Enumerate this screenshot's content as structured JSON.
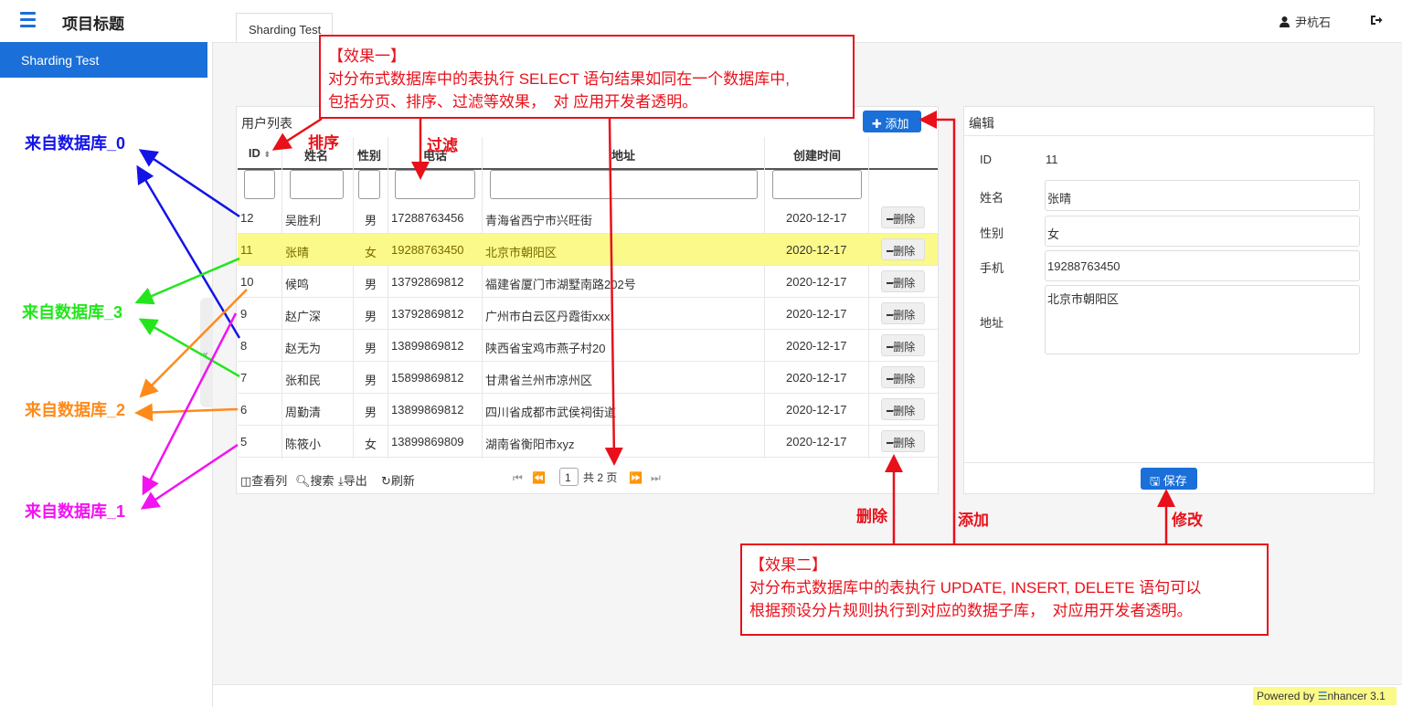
{
  "header": {
    "project_title": "项目标题",
    "tab": "Sharding Test",
    "user": "尹杭石"
  },
  "sidebar": {
    "items": [
      {
        "label": "Sharding Test"
      }
    ]
  },
  "db_labels": {
    "db0": "来自数据库_0",
    "db3": "来自数据库_3",
    "db2": "来自数据库_2",
    "db1": "来自数据库_1"
  },
  "callout1": {
    "title": "【效果一】",
    "line1": "对分布式数据库中的表执行 SELECT 语句结果如同在一个数据库中,",
    "line2": "包括分页、排序、过滤等效果，　对 应用开发者透明。"
  },
  "callout2": {
    "title": "【效果二】",
    "line1": "对分布式数据库中的表执行 UPDATE, INSERT, DELETE 语句可以",
    "line2": "根据预设分片规则执行到对应的数据子库，　对应用开发者透明。"
  },
  "annotations": {
    "sort": "排序",
    "filter": "过滤",
    "delete": "删除",
    "add": "添加",
    "modify": "修改"
  },
  "list_panel": {
    "title": "用户列表",
    "add_button": "添加",
    "columns": [
      "ID",
      "姓名",
      "性别",
      "电话",
      "地址",
      "创建时间"
    ],
    "delete_label": "删除",
    "rows": [
      {
        "id": "12",
        "name": "吴胜利",
        "gender": "男",
        "phone": "17288763456",
        "address": "青海省西宁市兴旺街",
        "created": "2020-12-17"
      },
      {
        "id": "11",
        "name": "张晴",
        "gender": "女",
        "phone": "19288763450",
        "address": "北京市朝阳区",
        "created": "2020-12-17"
      },
      {
        "id": "10",
        "name": "候鸣",
        "gender": "男",
        "phone": "13792869812",
        "address": "福建省厦门市湖墅南路202号",
        "created": "2020-12-17"
      },
      {
        "id": "9",
        "name": "赵广深",
        "gender": "男",
        "phone": "13792869812",
        "address": "广州市白云区丹霞街xxx",
        "created": "2020-12-17"
      },
      {
        "id": "8",
        "name": "赵无为",
        "gender": "男",
        "phone": "13899869812",
        "address": "陕西省宝鸡市燕子村20",
        "created": "2020-12-17"
      },
      {
        "id": "7",
        "name": "张和民",
        "gender": "男",
        "phone": "15899869812",
        "address": "甘肃省兰州市凉州区",
        "created": "2020-12-17"
      },
      {
        "id": "6",
        "name": "周勤清",
        "gender": "男",
        "phone": "13899869812",
        "address": "四川省成都市武侯祠街道",
        "created": "2020-12-17"
      },
      {
        "id": "5",
        "name": "陈筱小",
        "gender": "女",
        "phone": "13899869809",
        "address": "湖南省衡阳市xyz",
        "created": "2020-12-17"
      }
    ],
    "toolbar": {
      "columns": "查看列",
      "search": "搜索",
      "export": "导出",
      "refresh": "刷新"
    },
    "pager": {
      "page": "1",
      "total": "共 2 页"
    }
  },
  "edit_panel": {
    "title": "编辑",
    "id_label": "ID",
    "id_value": "11",
    "name_label": "姓名",
    "name_value": "张晴",
    "gender_label": "性别",
    "gender_value": "女",
    "phone_label": "手机",
    "phone_value": "19288763450",
    "address_label": "地址",
    "address_value": "北京市朝阳区",
    "save_button": "保存"
  },
  "footer": {
    "powered": "Powered by ",
    "brand_rest": "nhancer 3.1"
  },
  "colors": {
    "primary": "#1a6fd8",
    "highlight": "#fbf98a",
    "annotation": "#e8101a",
    "db0": "#1414e6",
    "db3": "#22e61c",
    "db2": "#ff8a1a",
    "db1": "#f212f2"
  }
}
